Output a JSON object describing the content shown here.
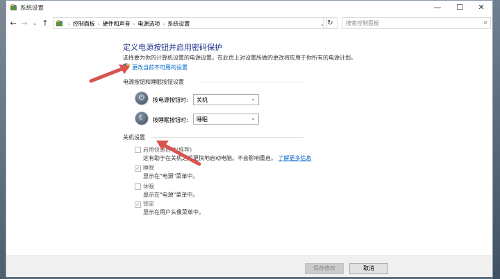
{
  "window": {
    "title": "系统设置"
  },
  "controls": {
    "minimize": "—",
    "maximize": "☐",
    "close": "✕"
  },
  "nav": {
    "back": "←",
    "forward": "→",
    "dropdown": "⌄",
    "up": "↑",
    "refresh": "↻"
  },
  "breadcrumb": {
    "sep": "›",
    "items": [
      "控制面板",
      "硬件和声音",
      "电源选项",
      "系统设置"
    ]
  },
  "search": {
    "placeholder": "搜索控制面板",
    "icon": "⌕"
  },
  "main": {
    "heading": "定义电源按钮并启用密码保护",
    "description": "选择要为你的计算机设置的电源设置。在此页上对设置所做的更改将应用于你所有的电源计划。",
    "change_link": "更改当前不可用的设置"
  },
  "power_section": {
    "title": "电源按钮和睡眠按钮设置",
    "power_button": {
      "label": "按电源按钮时:",
      "value": "关机"
    },
    "sleep_button": {
      "label": "按睡眠按钮时:",
      "value": "睡眠"
    }
  },
  "shutdown_section": {
    "title": "关机设置",
    "options": [
      {
        "label": "启用快速启动(推荐)",
        "checked": false,
        "desc": "这有助于在关机之后更快地启动电脑。不会影响重启。",
        "link": "了解更多信息"
      },
      {
        "label": "睡眠",
        "checked": true,
        "desc": "显示在\"电源\"菜单中。"
      },
      {
        "label": "休眠",
        "checked": false,
        "desc": "显示在\"电源\"菜单中。"
      },
      {
        "label": "锁定",
        "checked": true,
        "desc": "显示在用户头像菜单中。"
      }
    ]
  },
  "footer": {
    "save": "保存修改",
    "cancel": "取消"
  },
  "colors": {
    "heading": "#1e3287",
    "link": "#0066cc",
    "annotation_arrow": "#d9534f"
  }
}
